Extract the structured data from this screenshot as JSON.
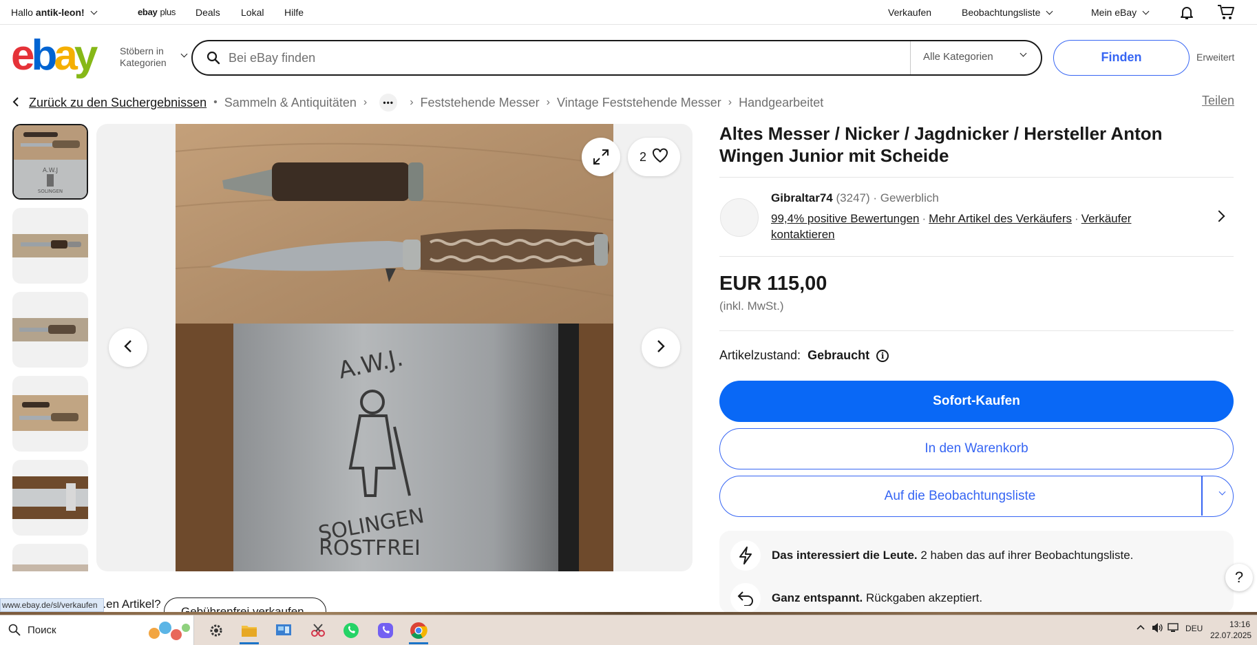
{
  "topbar": {
    "greeting_prefix": "Hallo ",
    "username": "antik-leon!",
    "ebayplus_brand": "ebay",
    "ebayplus_suffix": "plus",
    "deals": "Deals",
    "local": "Lokal",
    "help": "Hilfe",
    "sell": "Verkaufen",
    "watchlist": "Beobachtungsliste",
    "my_ebay": "Mein eBay"
  },
  "header": {
    "logo": {
      "e": "e",
      "b": "b",
      "a": "a",
      "y": "y"
    },
    "shop_by_category_line1": "Stöbern in",
    "shop_by_category_line2": "Kategorien",
    "search_placeholder": "Bei eBay finden",
    "category_select": "Alle Kategorien",
    "find_button": "Finden",
    "advanced": "Erweitert"
  },
  "breadcrumb": {
    "back": "Zurück zu den Suchergebnissen",
    "items": [
      "Sammeln & Antiquitäten",
      "Feststehende Messer",
      "Vintage Feststehende Messer",
      "Handgearbeitet"
    ],
    "share": "Teilen"
  },
  "gallery": {
    "thumbnail_count": 6,
    "active_index": 0,
    "watch_count": "2"
  },
  "listing": {
    "title": "Altes Messer / Nicker / Jagdnicker / Hersteller Anton Wingen Junior mit Scheide",
    "seller": {
      "name": "Gibraltar74",
      "feedback_count": "(3247)",
      "type": "Gewerblich",
      "positive": "99,4% positive Bewertungen",
      "more_items": "Mehr Artikel des Verkäufers",
      "contact": "Verkäufer kontaktieren"
    },
    "price": "EUR 115,00",
    "vat_note": "(inkl. MwSt.)",
    "condition_label": "Artikelzustand:",
    "condition_value": "Gebraucht",
    "buy_now": "Sofort-Kaufen",
    "add_to_cart": "In den Warenkorb",
    "add_to_watchlist": "Auf die Beobachtungsliste",
    "info_watch_bold": "Das interessiert die Leute.",
    "info_watch_text": " 2 haben das auf ihrer Beobachtungsliste.",
    "info_returns_bold": "Ganz entspannt.",
    "info_returns_text": " Rückgaben akzeptiert."
  },
  "below": {
    "partial_text": "...en Artikel?",
    "sell_button": "Gebührenfrei verkaufen"
  },
  "status_bar_url": "www.ebay.de/sl/verkaufen",
  "taskbar": {
    "search_text": "Поиск",
    "language": "DEU",
    "time": "13:16",
    "date": "22.07.2025"
  },
  "colors": {
    "accent_blue": "#3665f3",
    "buy_blue": "#0968f6",
    "logo_red": "#e53238",
    "logo_blue": "#0064d2",
    "logo_yellow": "#f5af02",
    "logo_green": "#86b817"
  }
}
